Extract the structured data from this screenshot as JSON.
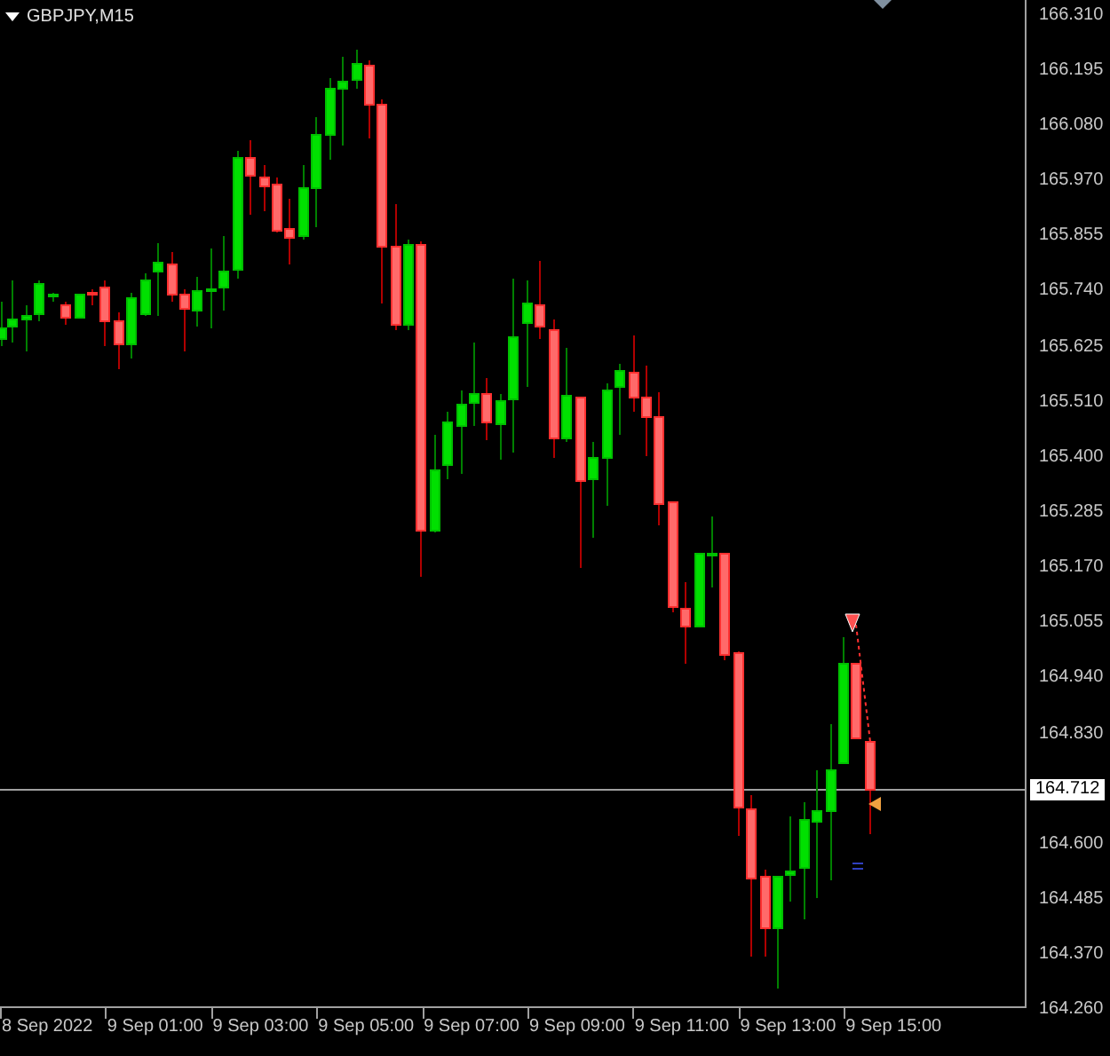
{
  "chart": {
    "title": "GBPJPY,M15",
    "price_labels": [
      {
        "text": "166.310",
        "kind": "tick"
      },
      {
        "text": "166.195",
        "kind": "tick"
      },
      {
        "text": "166.080",
        "kind": "tick"
      },
      {
        "text": "165.970",
        "kind": "tick"
      },
      {
        "text": "165.855",
        "kind": "tick"
      },
      {
        "text": "165.740",
        "kind": "tick"
      },
      {
        "text": "165.625",
        "kind": "tick"
      },
      {
        "text": "165.510",
        "kind": "tick"
      },
      {
        "text": "165.400",
        "kind": "tick"
      },
      {
        "text": "165.285",
        "kind": "tick"
      },
      {
        "text": "165.170",
        "kind": "tick"
      },
      {
        "text": "165.055",
        "kind": "tick"
      },
      {
        "text": "164.940",
        "kind": "tick"
      },
      {
        "text": "164.830",
        "kind": "tick"
      },
      {
        "text": "164.712",
        "kind": "current"
      },
      {
        "text": "164.600",
        "kind": "tick"
      },
      {
        "text": "164.485",
        "kind": "tick"
      },
      {
        "text": "164.370",
        "kind": "tick"
      },
      {
        "text": "164.260",
        "kind": "tick"
      }
    ],
    "time_labels": [
      "8 Sep 2022",
      "9 Sep 01:00",
      "9 Sep 03:00",
      "9 Sep 05:00",
      "9 Sep 07:00",
      "9 Sep 09:00",
      "9 Sep 11:00",
      "9 Sep 13:00",
      "9 Sep 15:00"
    ]
  }
}
